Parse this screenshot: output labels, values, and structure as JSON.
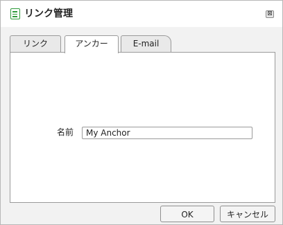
{
  "dialog": {
    "title": "リンク管理",
    "close_glyph": "⊠",
    "icon": "document-list-icon"
  },
  "tabs": [
    {
      "label": "リンク",
      "active": false
    },
    {
      "label": "アンカー",
      "active": true
    },
    {
      "label": "E-mail",
      "active": false
    }
  ],
  "form": {
    "name_label": "名前",
    "name_value": "My Anchor"
  },
  "buttons": {
    "ok_label": "OK",
    "cancel_label": "キャンセル"
  },
  "colors": {
    "title_icon": "#2e9a3a",
    "dialog_bg": "#f2f2f2",
    "panel_bg": "#ffffff",
    "border": "#9a9a9a"
  }
}
